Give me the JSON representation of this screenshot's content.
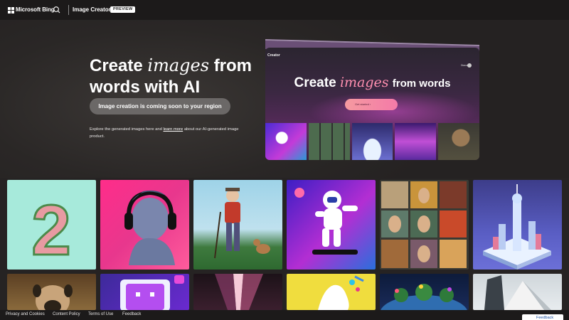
{
  "header": {
    "brand": "Microsoft Bing",
    "app_title": "Image Creator",
    "badge": "PREVIEW"
  },
  "hero": {
    "title_part1": "Create",
    "title_italic": "images",
    "title_part2": "from words with AI",
    "cta": "Image creation is coming soon to your region",
    "explore_before": "Explore the generated images here and",
    "explore_link": "learn more",
    "explore_after": "about our AI-generated image product."
  },
  "mockup": {
    "app_name": "Creator",
    "user": "Diana",
    "heading_part1": "Create",
    "heading_italic": "images",
    "heading_part2": "from words",
    "button": "Get started"
  },
  "gallery": {
    "items": [
      "2",
      "bust-with-headphones",
      "old-man-walking-dog",
      "astronaut-skateboard",
      "portrait-grid",
      "isometric-city",
      "pug",
      "tv-character",
      "abstract-light",
      "yellow-splash",
      "floral-planet",
      "geometric-shapes"
    ]
  },
  "footer": {
    "links": [
      "Privacy and Cookies",
      "Content Policy",
      "Terms of Use",
      "Feedback"
    ],
    "feedback_button": "Feedback"
  },
  "colors": {
    "background": "#262323",
    "header": "#1c1a1a",
    "cta": "#6b6867",
    "accent_pink": "#f47aa8"
  }
}
